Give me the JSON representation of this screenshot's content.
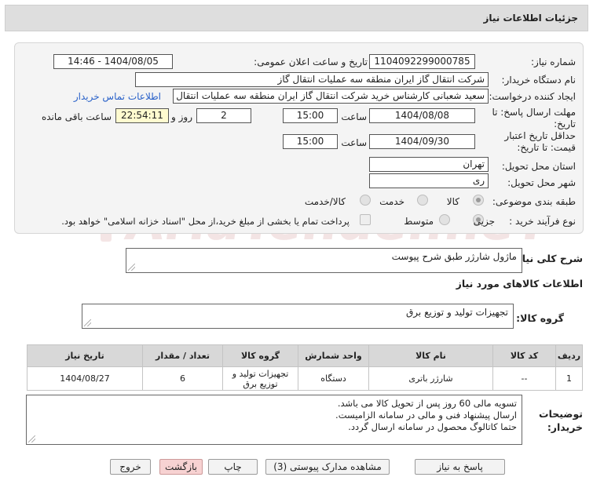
{
  "header": {
    "title": "جزئیات اطلاعات نیاز"
  },
  "form": {
    "need_number_label": "شماره نیاز:",
    "need_number": "1104092299000785",
    "announce_label": "تاریخ و ساعت اعلان عمومی:",
    "announce_value": "1404/08/05 - 14:46",
    "buyer_org_label": "نام دستگاه خریدار:",
    "buyer_org": "شرکت انتقال گاز ایران منطقه سه عملیات انتقال گاز",
    "creator_label": "ایجاد کننده درخواست:",
    "creator": "سعید شعبانی کارشناس خرید شرکت انتقال گاز ایران منطقه سه عملیات انتقال",
    "contact_link": "اطلاعات تماس خریدار",
    "reply_deadline_label_1": "مهلت ارسال پاسخ: تا",
    "reply_deadline_label_2": "تاریخ:",
    "reply_date": "1404/08/08",
    "time_label": "ساعت",
    "reply_time": "15:00",
    "days_value": "2",
    "days_label": "روز و",
    "remaining_time": "22:54:11",
    "remaining_label": "ساعت باقی مانده",
    "price_validity_label_1": "حداقل تاریخ اعتبار",
    "price_validity_label_2": "قیمت: تا تاریخ:",
    "validity_date": "1404/09/30",
    "validity_time": "15:00",
    "province_label": "استان محل تحویل:",
    "province": "تهران",
    "city_label": "شهر محل تحویل:",
    "city": "ری",
    "category_label": "طبقه بندی موضوعی:",
    "category_options": [
      "کالا",
      "خدمت",
      "کالا/خدمت"
    ],
    "process_label": "نوع فرآیند خرید :",
    "process_options": [
      "جزیی",
      "متوسط"
    ],
    "payment_note": "پرداخت تمام یا بخشی از مبلغ خرید،از محل \"اسناد خزانه اسلامی\" خواهد بود."
  },
  "description": {
    "label": "شرح کلی نیاز:",
    "value": "ماژول شارژر طبق شرح پیوست"
  },
  "goods_info": {
    "title": "اطلاعات کالاهای مورد نیاز",
    "group_label": "گروه کالا:",
    "group_value": "تجهیزات تولید و توزیع برق"
  },
  "table": {
    "headers": [
      "ردیف",
      "کد کالا",
      "نام کالا",
      "واحد شمارش",
      "گروه کالا",
      "تعداد / مقدار",
      "تاریخ نیاز"
    ],
    "rows": [
      [
        "1",
        "--",
        "شارژر باتری",
        "دستگاه",
        "تجهیزات تولید و توزیع برق",
        "6",
        "1404/08/27"
      ]
    ]
  },
  "buyer_notes": {
    "label_1": "توضیحات",
    "label_2": "خریدار:",
    "lines": [
      "تسویه مالی 60 روز پس از تحویل کالا می باشد.",
      "ارسال پیشنهاد فنی و مالی در سامانه الزامیست.",
      "حتما کاتالوگ محصول در سامانه ارسال گردد."
    ]
  },
  "buttons": {
    "reply": "پاسخ به نیاز",
    "attachments": "مشاهده مدارک پیوستی (3)",
    "print": "چاپ",
    "back": "بازگشت",
    "exit": "خروج"
  },
  "watermark": {
    "text": "AriaTender.neT"
  },
  "colors": {
    "link": "#2a62c9",
    "highlight": "#fffbd0",
    "button_pink": "#f7d2d2",
    "watermark": "#e9c9c9"
  }
}
